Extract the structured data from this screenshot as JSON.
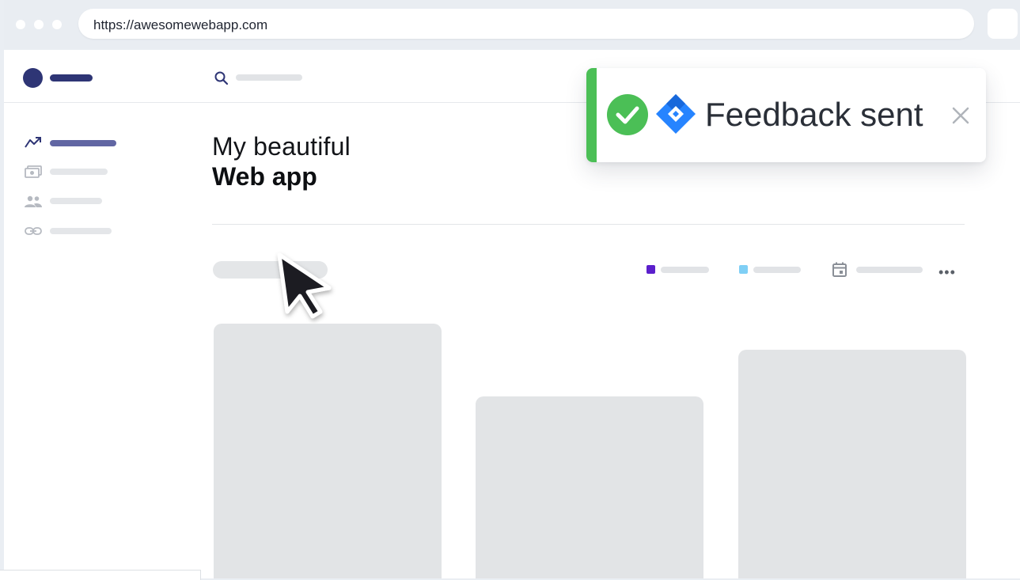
{
  "browser": {
    "url": "https://awesomewebapp.com"
  },
  "page": {
    "heading_light": "My beautiful",
    "heading_bold": "Web app"
  },
  "toast": {
    "message": "Feedback sent",
    "status": "success",
    "accent_color": "#4bbf56"
  },
  "sidebar": {
    "items": [
      {
        "icon": "trending-icon",
        "active": true
      },
      {
        "icon": "money-icon",
        "active": false
      },
      {
        "icon": "people-icon",
        "active": false
      },
      {
        "icon": "link-icon",
        "active": false
      }
    ]
  },
  "legend": [
    {
      "color": "#5b1fcc"
    },
    {
      "color": "#7fcff5"
    }
  ],
  "icons": [
    "search-icon",
    "calendar-icon",
    "more-icon",
    "check-icon",
    "jira-icon",
    "close-icon",
    "cursor-icon"
  ],
  "colors": {
    "brand": "#2e3575",
    "placeholder": "#e2e4e6"
  }
}
